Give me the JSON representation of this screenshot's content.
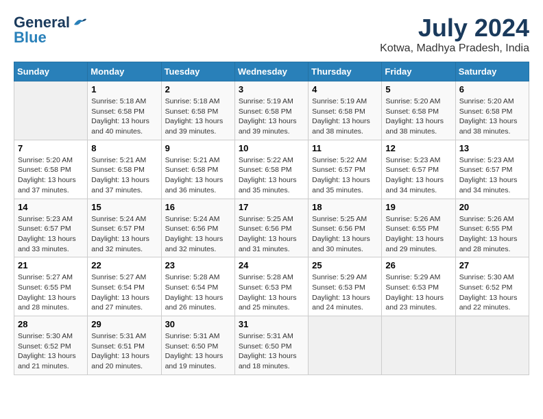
{
  "header": {
    "logo_line1": "General",
    "logo_line2": "Blue",
    "month_year": "July 2024",
    "location": "Kotwa, Madhya Pradesh, India"
  },
  "days_of_week": [
    "Sunday",
    "Monday",
    "Tuesday",
    "Wednesday",
    "Thursday",
    "Friday",
    "Saturday"
  ],
  "weeks": [
    [
      {
        "day": "",
        "content": ""
      },
      {
        "day": "1",
        "content": "Sunrise: 5:18 AM\nSunset: 6:58 PM\nDaylight: 13 hours and 40 minutes."
      },
      {
        "day": "2",
        "content": "Sunrise: 5:18 AM\nSunset: 6:58 PM\nDaylight: 13 hours and 39 minutes."
      },
      {
        "day": "3",
        "content": "Sunrise: 5:19 AM\nSunset: 6:58 PM\nDaylight: 13 hours and 39 minutes."
      },
      {
        "day": "4",
        "content": "Sunrise: 5:19 AM\nSunset: 6:58 PM\nDaylight: 13 hours and 38 minutes."
      },
      {
        "day": "5",
        "content": "Sunrise: 5:20 AM\nSunset: 6:58 PM\nDaylight: 13 hours and 38 minutes."
      },
      {
        "day": "6",
        "content": "Sunrise: 5:20 AM\nSunset: 6:58 PM\nDaylight: 13 hours and 38 minutes."
      }
    ],
    [
      {
        "day": "7",
        "content": ""
      },
      {
        "day": "8",
        "content": "Sunrise: 5:21 AM\nSunset: 6:58 PM\nDaylight: 13 hours and 37 minutes."
      },
      {
        "day": "9",
        "content": "Sunrise: 5:21 AM\nSunset: 6:58 PM\nDaylight: 13 hours and 36 minutes."
      },
      {
        "day": "10",
        "content": "Sunrise: 5:22 AM\nSunset: 6:58 PM\nDaylight: 13 hours and 35 minutes."
      },
      {
        "day": "11",
        "content": "Sunrise: 5:22 AM\nSunset: 6:57 PM\nDaylight: 13 hours and 35 minutes."
      },
      {
        "day": "12",
        "content": "Sunrise: 5:23 AM\nSunset: 6:57 PM\nDaylight: 13 hours and 34 minutes."
      },
      {
        "day": "13",
        "content": "Sunrise: 5:23 AM\nSunset: 6:57 PM\nDaylight: 13 hours and 34 minutes."
      }
    ],
    [
      {
        "day": "14",
        "content": ""
      },
      {
        "day": "15",
        "content": "Sunrise: 5:24 AM\nSunset: 6:57 PM\nDaylight: 13 hours and 32 minutes."
      },
      {
        "day": "16",
        "content": "Sunrise: 5:24 AM\nSunset: 6:56 PM\nDaylight: 13 hours and 32 minutes."
      },
      {
        "day": "17",
        "content": "Sunrise: 5:25 AM\nSunset: 6:56 PM\nDaylight: 13 hours and 31 minutes."
      },
      {
        "day": "18",
        "content": "Sunrise: 5:25 AM\nSunset: 6:56 PM\nDaylight: 13 hours and 30 minutes."
      },
      {
        "day": "19",
        "content": "Sunrise: 5:26 AM\nSunset: 6:55 PM\nDaylight: 13 hours and 29 minutes."
      },
      {
        "day": "20",
        "content": "Sunrise: 5:26 AM\nSunset: 6:55 PM\nDaylight: 13 hours and 28 minutes."
      }
    ],
    [
      {
        "day": "21",
        "content": ""
      },
      {
        "day": "22",
        "content": "Sunrise: 5:27 AM\nSunset: 6:54 PM\nDaylight: 13 hours and 27 minutes."
      },
      {
        "day": "23",
        "content": "Sunrise: 5:28 AM\nSunset: 6:54 PM\nDaylight: 13 hours and 26 minutes."
      },
      {
        "day": "24",
        "content": "Sunrise: 5:28 AM\nSunset: 6:53 PM\nDaylight: 13 hours and 25 minutes."
      },
      {
        "day": "25",
        "content": "Sunrise: 5:29 AM\nSunset: 6:53 PM\nDaylight: 13 hours and 24 minutes."
      },
      {
        "day": "26",
        "content": "Sunrise: 5:29 AM\nSunset: 6:53 PM\nDaylight: 13 hours and 23 minutes."
      },
      {
        "day": "27",
        "content": "Sunrise: 5:30 AM\nSunset: 6:52 PM\nDaylight: 13 hours and 22 minutes."
      }
    ],
    [
      {
        "day": "28",
        "content": "Sunrise: 5:30 AM\nSunset: 6:52 PM\nDaylight: 13 hours and 21 minutes."
      },
      {
        "day": "29",
        "content": "Sunrise: 5:31 AM\nSunset: 6:51 PM\nDaylight: 13 hours and 20 minutes."
      },
      {
        "day": "30",
        "content": "Sunrise: 5:31 AM\nSunset: 6:50 PM\nDaylight: 13 hours and 19 minutes."
      },
      {
        "day": "31",
        "content": "Sunrise: 5:31 AM\nSunset: 6:50 PM\nDaylight: 13 hours and 18 minutes."
      },
      {
        "day": "",
        "content": ""
      },
      {
        "day": "",
        "content": ""
      },
      {
        "day": "",
        "content": ""
      }
    ]
  ],
  "week7_sunday_content": "Sunrise: 5:20 AM\nSunset: 6:58 PM\nDaylight: 13 hours and 37 minutes.",
  "week14_sunday_content": "Sunrise: 5:23 AM\nSunset: 6:57 PM\nDaylight: 13 hours and 33 minutes.",
  "week21_sunday_content": "Sunrise: 5:27 AM\nSunset: 6:55 PM\nDaylight: 13 hours and 28 minutes."
}
